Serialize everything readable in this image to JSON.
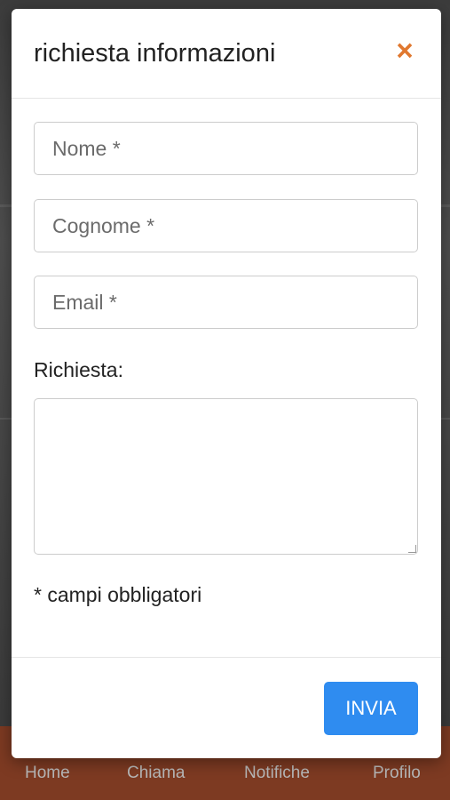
{
  "modal": {
    "title": "richiesta informazioni",
    "close_symbol": "×"
  },
  "form": {
    "nome_placeholder": "Nome *",
    "cognome_placeholder": "Cognome *",
    "email_placeholder": "Email *",
    "richiesta_label": "Richiesta:",
    "richiesta_value": "",
    "required_note": "* campi obbligatori",
    "submit_label": "INVIA"
  },
  "tabbar": {
    "items": [
      {
        "label": "Home",
        "icon": "home-icon"
      },
      {
        "label": "Chiama",
        "icon": "phone-icon"
      },
      {
        "label": "Notifiche",
        "icon": "bell-icon"
      },
      {
        "label": "Profilo",
        "icon": "user-icon"
      }
    ]
  },
  "colors": {
    "accent": "#e0782f",
    "primary_button": "#2f8cf0",
    "tabbar_bg": "#7d3a22"
  }
}
